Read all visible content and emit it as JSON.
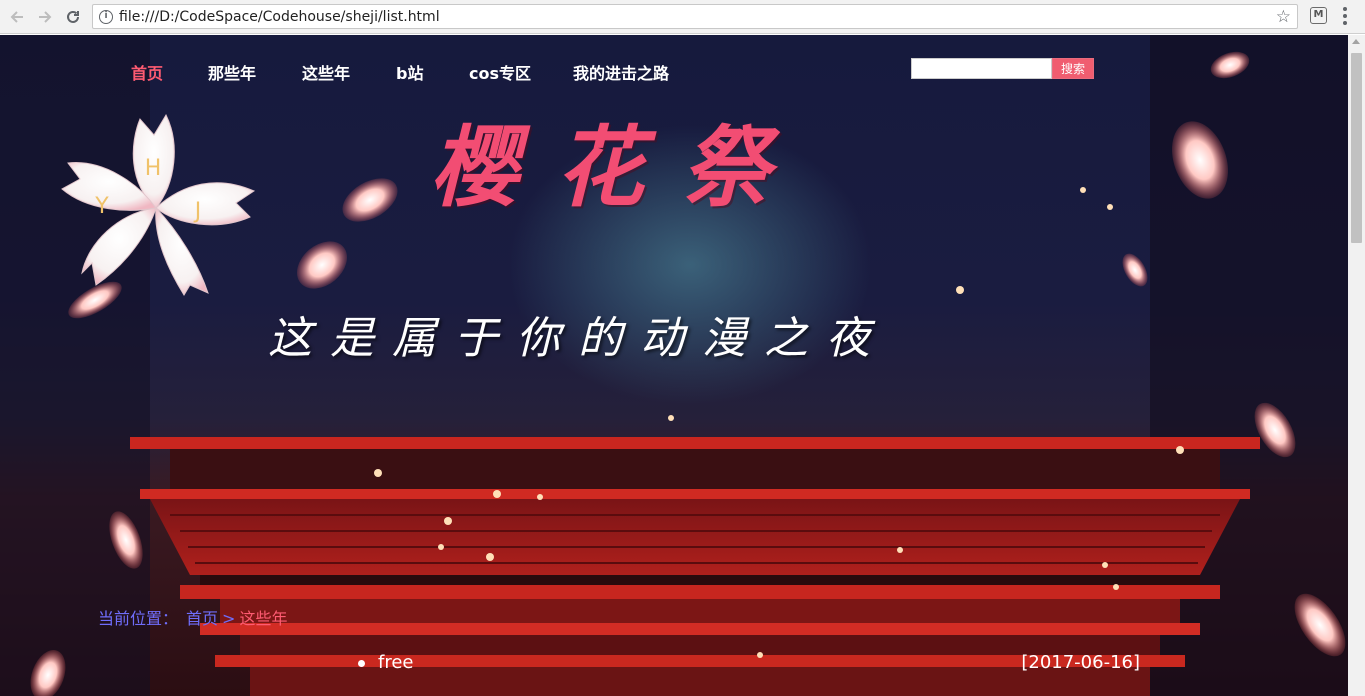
{
  "browser": {
    "url": "file:///D:/CodeSpace/Codehouse/sheji/list.html"
  },
  "nav": {
    "items": [
      {
        "label": "首页",
        "active": true
      },
      {
        "label": "那些年",
        "active": false
      },
      {
        "label": "这些年",
        "active": false
      },
      {
        "label": "b站",
        "active": false
      },
      {
        "label": "cos专区",
        "active": false
      },
      {
        "label": "我的进击之路",
        "active": false
      }
    ],
    "search_value": "",
    "search_button": "搜索"
  },
  "logo": {
    "letters": [
      "H",
      "Y",
      "J"
    ]
  },
  "banner": {
    "title": "樱花祭",
    "slogan": "这是属于你的动漫之夜"
  },
  "breadcrumb": {
    "label": "当前位置：",
    "home": "首页",
    "separator": ">",
    "current": "这些年"
  },
  "articles": [
    {
      "title": "free",
      "date": "[2017-06-16]"
    }
  ],
  "colors": {
    "accent": "#ff5b72",
    "breadcrumb_link": "#6f6dfa",
    "title": "#f24d73"
  }
}
